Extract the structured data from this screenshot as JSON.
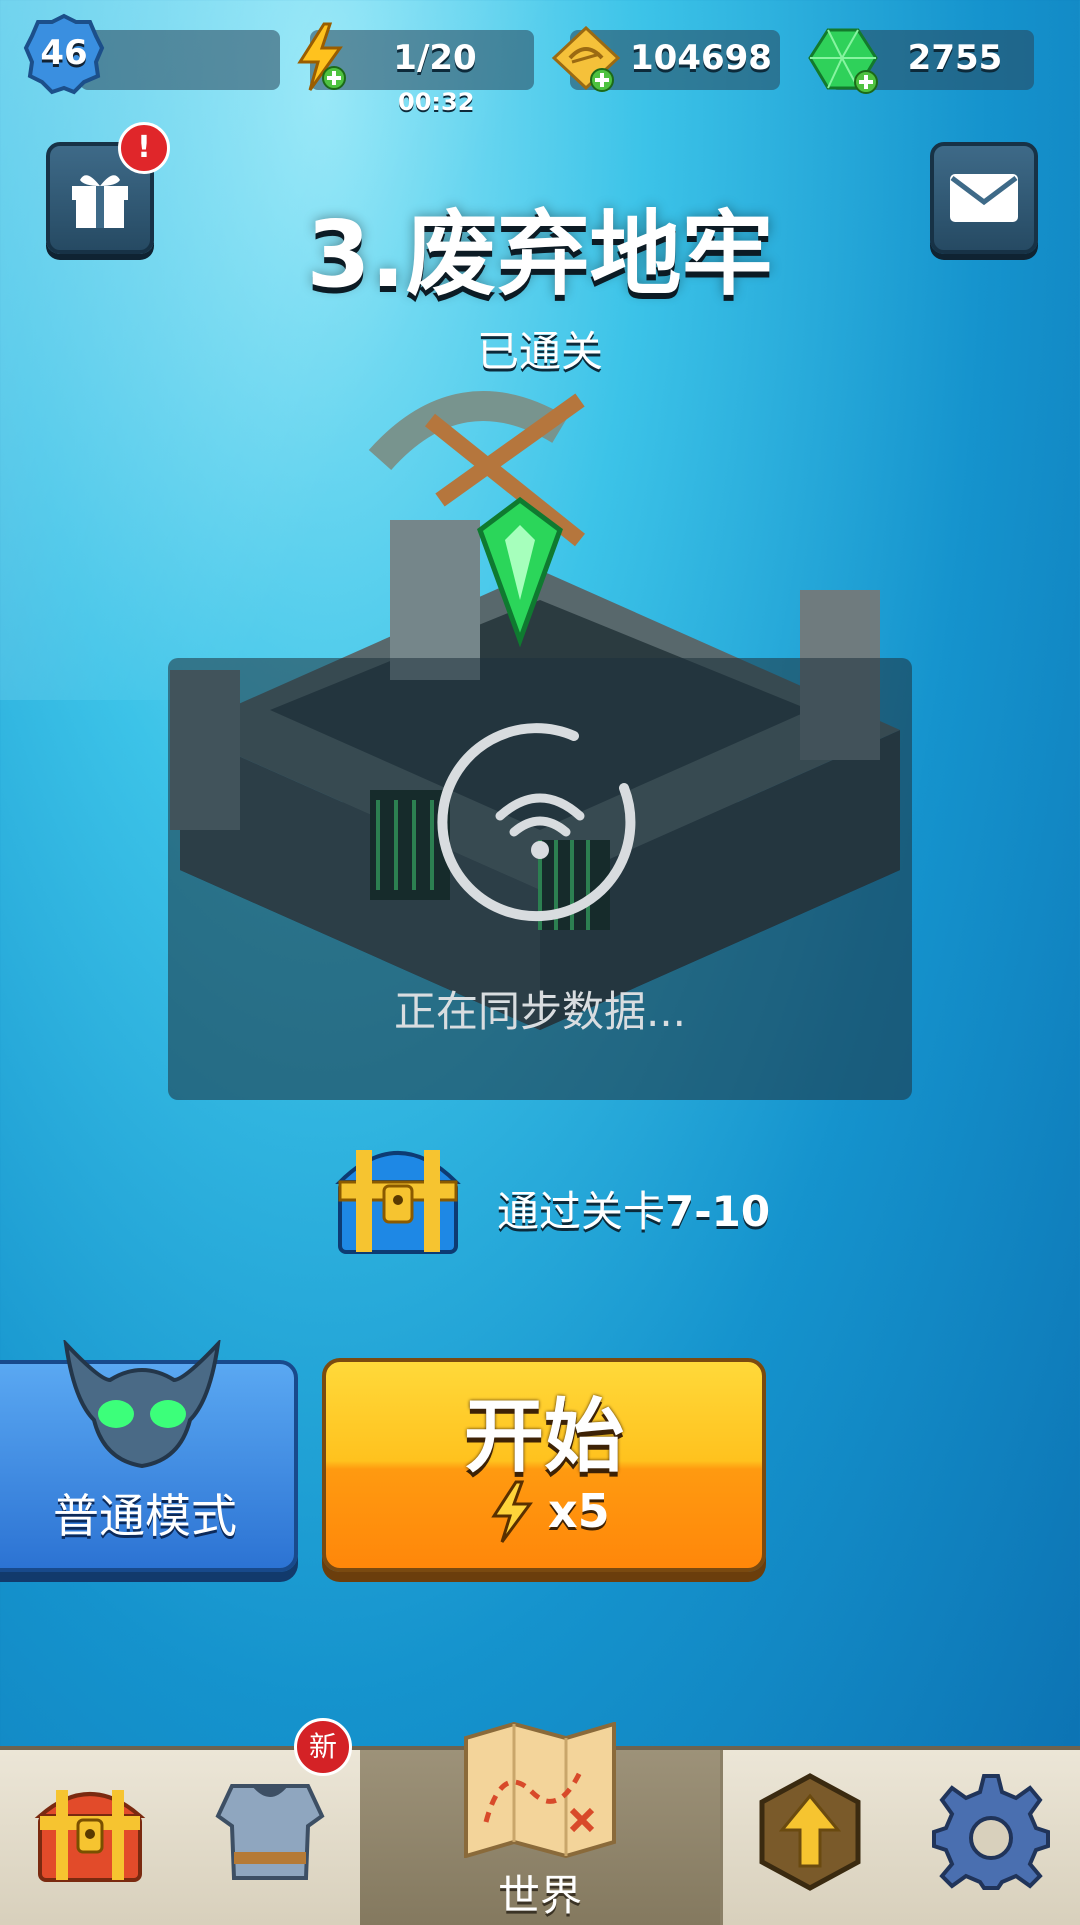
{
  "hud": {
    "player_level": "46",
    "energy": "1/20",
    "energy_timer": "00:32",
    "gold": "104698",
    "gems": "2755"
  },
  "buttons": {
    "gift_notification": "!",
    "mail": ""
  },
  "stage": {
    "title": "3.废弃地牢",
    "status": "已通关"
  },
  "sync": {
    "text": "正在同步数据..."
  },
  "reward": {
    "prefix": "通过关卡",
    "stage": "7-10"
  },
  "mode": {
    "label": "普通模式"
  },
  "start": {
    "label": "开始",
    "cost": "x5"
  },
  "nav": {
    "items": [
      {
        "name": "shop",
        "icon": "chest-icon"
      },
      {
        "name": "equipment",
        "icon": "armor-icon",
        "badge": "新"
      },
      {
        "name": "world",
        "icon": "map-icon",
        "label": "世界",
        "active": true
      },
      {
        "name": "talents",
        "icon": "upgrade-icon"
      },
      {
        "name": "settings",
        "icon": "gear-icon"
      }
    ]
  },
  "colors": {
    "ocean_top": "#3cc3e8",
    "ocean_bottom": "#0b6fb0",
    "start_button": "#ffc21e",
    "mode_button": "#2c73d3",
    "gem": "#2fd15a"
  }
}
